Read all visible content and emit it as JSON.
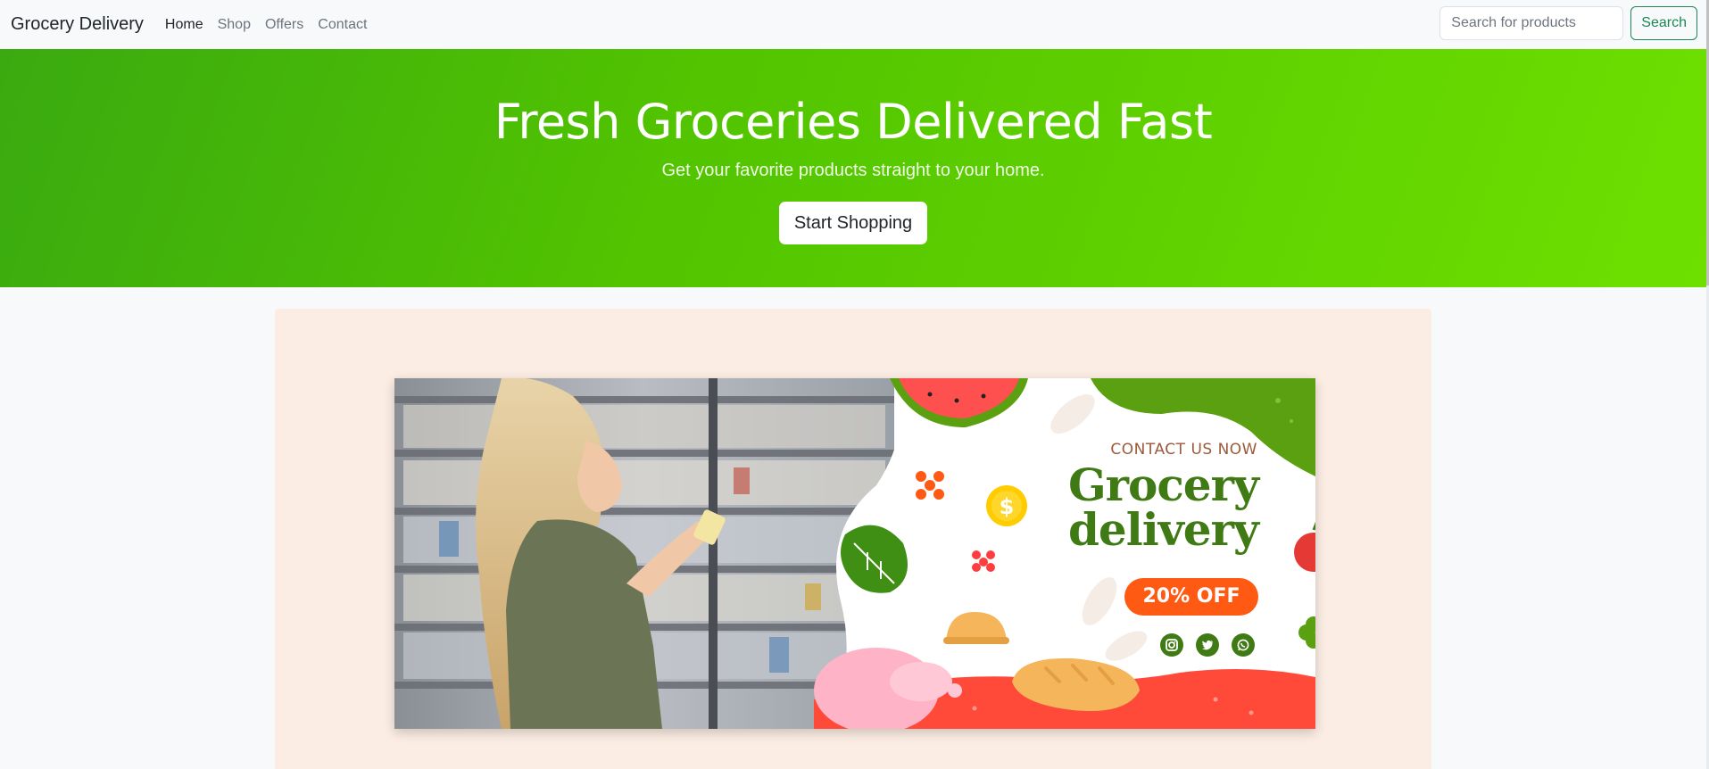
{
  "navbar": {
    "brand": "Grocery Delivery",
    "links": [
      {
        "label": "Home",
        "active": true
      },
      {
        "label": "Shop",
        "active": false
      },
      {
        "label": "Offers",
        "active": false
      },
      {
        "label": "Contact",
        "active": false
      }
    ],
    "search": {
      "placeholder": "Search for products",
      "value": "",
      "button_label": "Search"
    }
  },
  "hero": {
    "title": "Fresh Groceries Delivered Fast",
    "subtitle": "Get your favorite products straight to your home.",
    "cta_label": "Start Shopping"
  },
  "banner": {
    "contact_line": "CONTACT US NOW",
    "title_line1": "Grocery",
    "title_line2": "delivery",
    "offer": "20% OFF",
    "social_icons": [
      "instagram-icon",
      "twitter-icon",
      "whatsapp-icon"
    ]
  },
  "colors": {
    "hero_gradient_start": "#3aaa10",
    "hero_gradient_end": "#6ee000",
    "search_button": "#198754",
    "promo_panel": "#fbede3",
    "banner_title": "#3f7a14",
    "offer_pill": "#ff5a14"
  }
}
